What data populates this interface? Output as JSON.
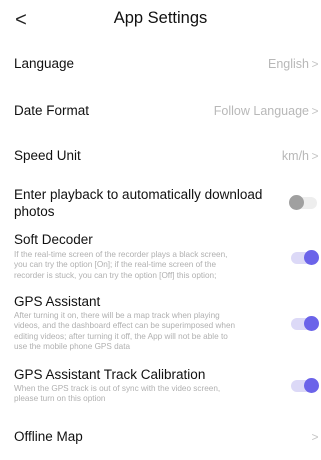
{
  "header": {
    "back_glyph": "<",
    "title": "App Settings"
  },
  "settings": {
    "language": {
      "label": "Language",
      "value": "English",
      "chevron": ">"
    },
    "date_format": {
      "label": "Date Format",
      "value": "Follow Language",
      "chevron": ">"
    },
    "speed_unit": {
      "label": "Speed Unit",
      "value": "km/h",
      "chevron": ">"
    },
    "auto_download": {
      "label_line1": "Enter playback to automatically download",
      "label_line2": "photos",
      "toggle": "off"
    },
    "soft_decoder": {
      "label": "Soft Decoder",
      "desc_lines": [
        "If the real-time screen of the recorder plays a black screen,",
        "you can try the option [On]; if the real-time screen of the",
        "recorder is stuck, you can try the option [Off] this option;"
      ],
      "toggle": "on"
    },
    "gps_assistant": {
      "label": "GPS Assistant",
      "desc_lines": [
        "After turning it on, there will be a map track when playing",
        "videos, and the dashboard effect can be superimposed when",
        "editing videos; after turning it off, the App will not be able to",
        "use the mobile phone GPS data"
      ],
      "toggle": "on"
    },
    "gps_calibration": {
      "label": "GPS Assistant Track Calibration",
      "desc_lines": [
        "When the GPS track is out of sync with the video screen,",
        "please turn on this option"
      ],
      "toggle": "on"
    },
    "offline_map": {
      "label": "Offline Map",
      "chevron": ">"
    }
  },
  "colors": {
    "accent": "#6b63e9",
    "toggle_on_track": "#dcd9f7",
    "toggle_off_track": "#eeeeee",
    "toggle_off_knob": "#a0a0a0",
    "secondary_text": "#b8b8b8"
  }
}
